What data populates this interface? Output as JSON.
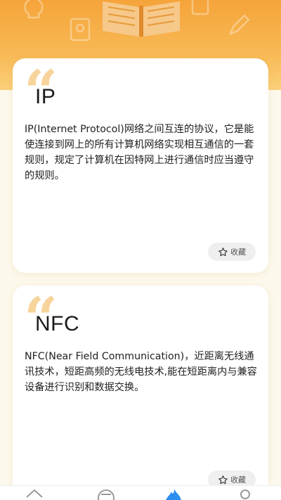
{
  "header": {
    "background_colors": [
      "#f5a43a",
      "#fbd07a"
    ],
    "icons": [
      "bulb-icon",
      "book-icon",
      "notebook-icon",
      "pencil-icon"
    ]
  },
  "cards": [
    {
      "quote_glyph": "“",
      "term": "IP",
      "description": "IP(Internet Protocol)网络之间互连的协议，它是能使连接到网上的所有计算机网络实现相互通信的一套规则，规定了计算机在因特网上进行通信时应当遵守的规则。",
      "favorite_label": "收藏"
    },
    {
      "quote_glyph": "“",
      "term": "NFC",
      "description": "NFC(Near Field Communication)，近距离无线通讯技术，短距高频的无线电技术,能在短距离内与兼容设备进行识别和数据交换。",
      "favorite_label": "收藏"
    }
  ],
  "bottom_nav": {
    "items": [
      "home-icon",
      "discover-icon",
      "flame-icon",
      "profile-icon"
    ],
    "active": "flame-icon",
    "active_color": "#2e8ef0"
  }
}
